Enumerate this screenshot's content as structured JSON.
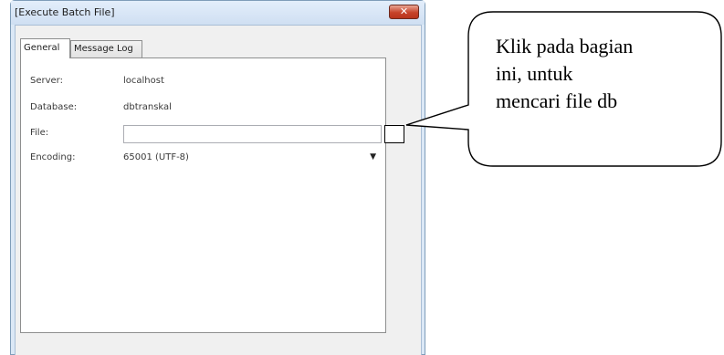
{
  "window": {
    "title": "[Execute Batch File]",
    "close_glyph": "✕"
  },
  "tabs": [
    {
      "label": "General",
      "active": true
    },
    {
      "label": "Message Log",
      "active": false
    }
  ],
  "form": {
    "server_label": "Server:",
    "server_value": "localhost",
    "database_label": "Database:",
    "database_value": "dbtranskal",
    "file_label": "File:",
    "file_value": "",
    "encoding_label": "Encoding:",
    "encoding_value": "65001 (UTF-8)",
    "encoding_arrow": "▼"
  },
  "annotation": {
    "line1": "Klik pada bagian",
    "line2": "ini, untuk",
    "line3": "mencari file db"
  },
  "colors": {
    "window_frame": "#dbe8f6",
    "close_button": "#c7432a",
    "panel_bg": "#ffffff"
  }
}
